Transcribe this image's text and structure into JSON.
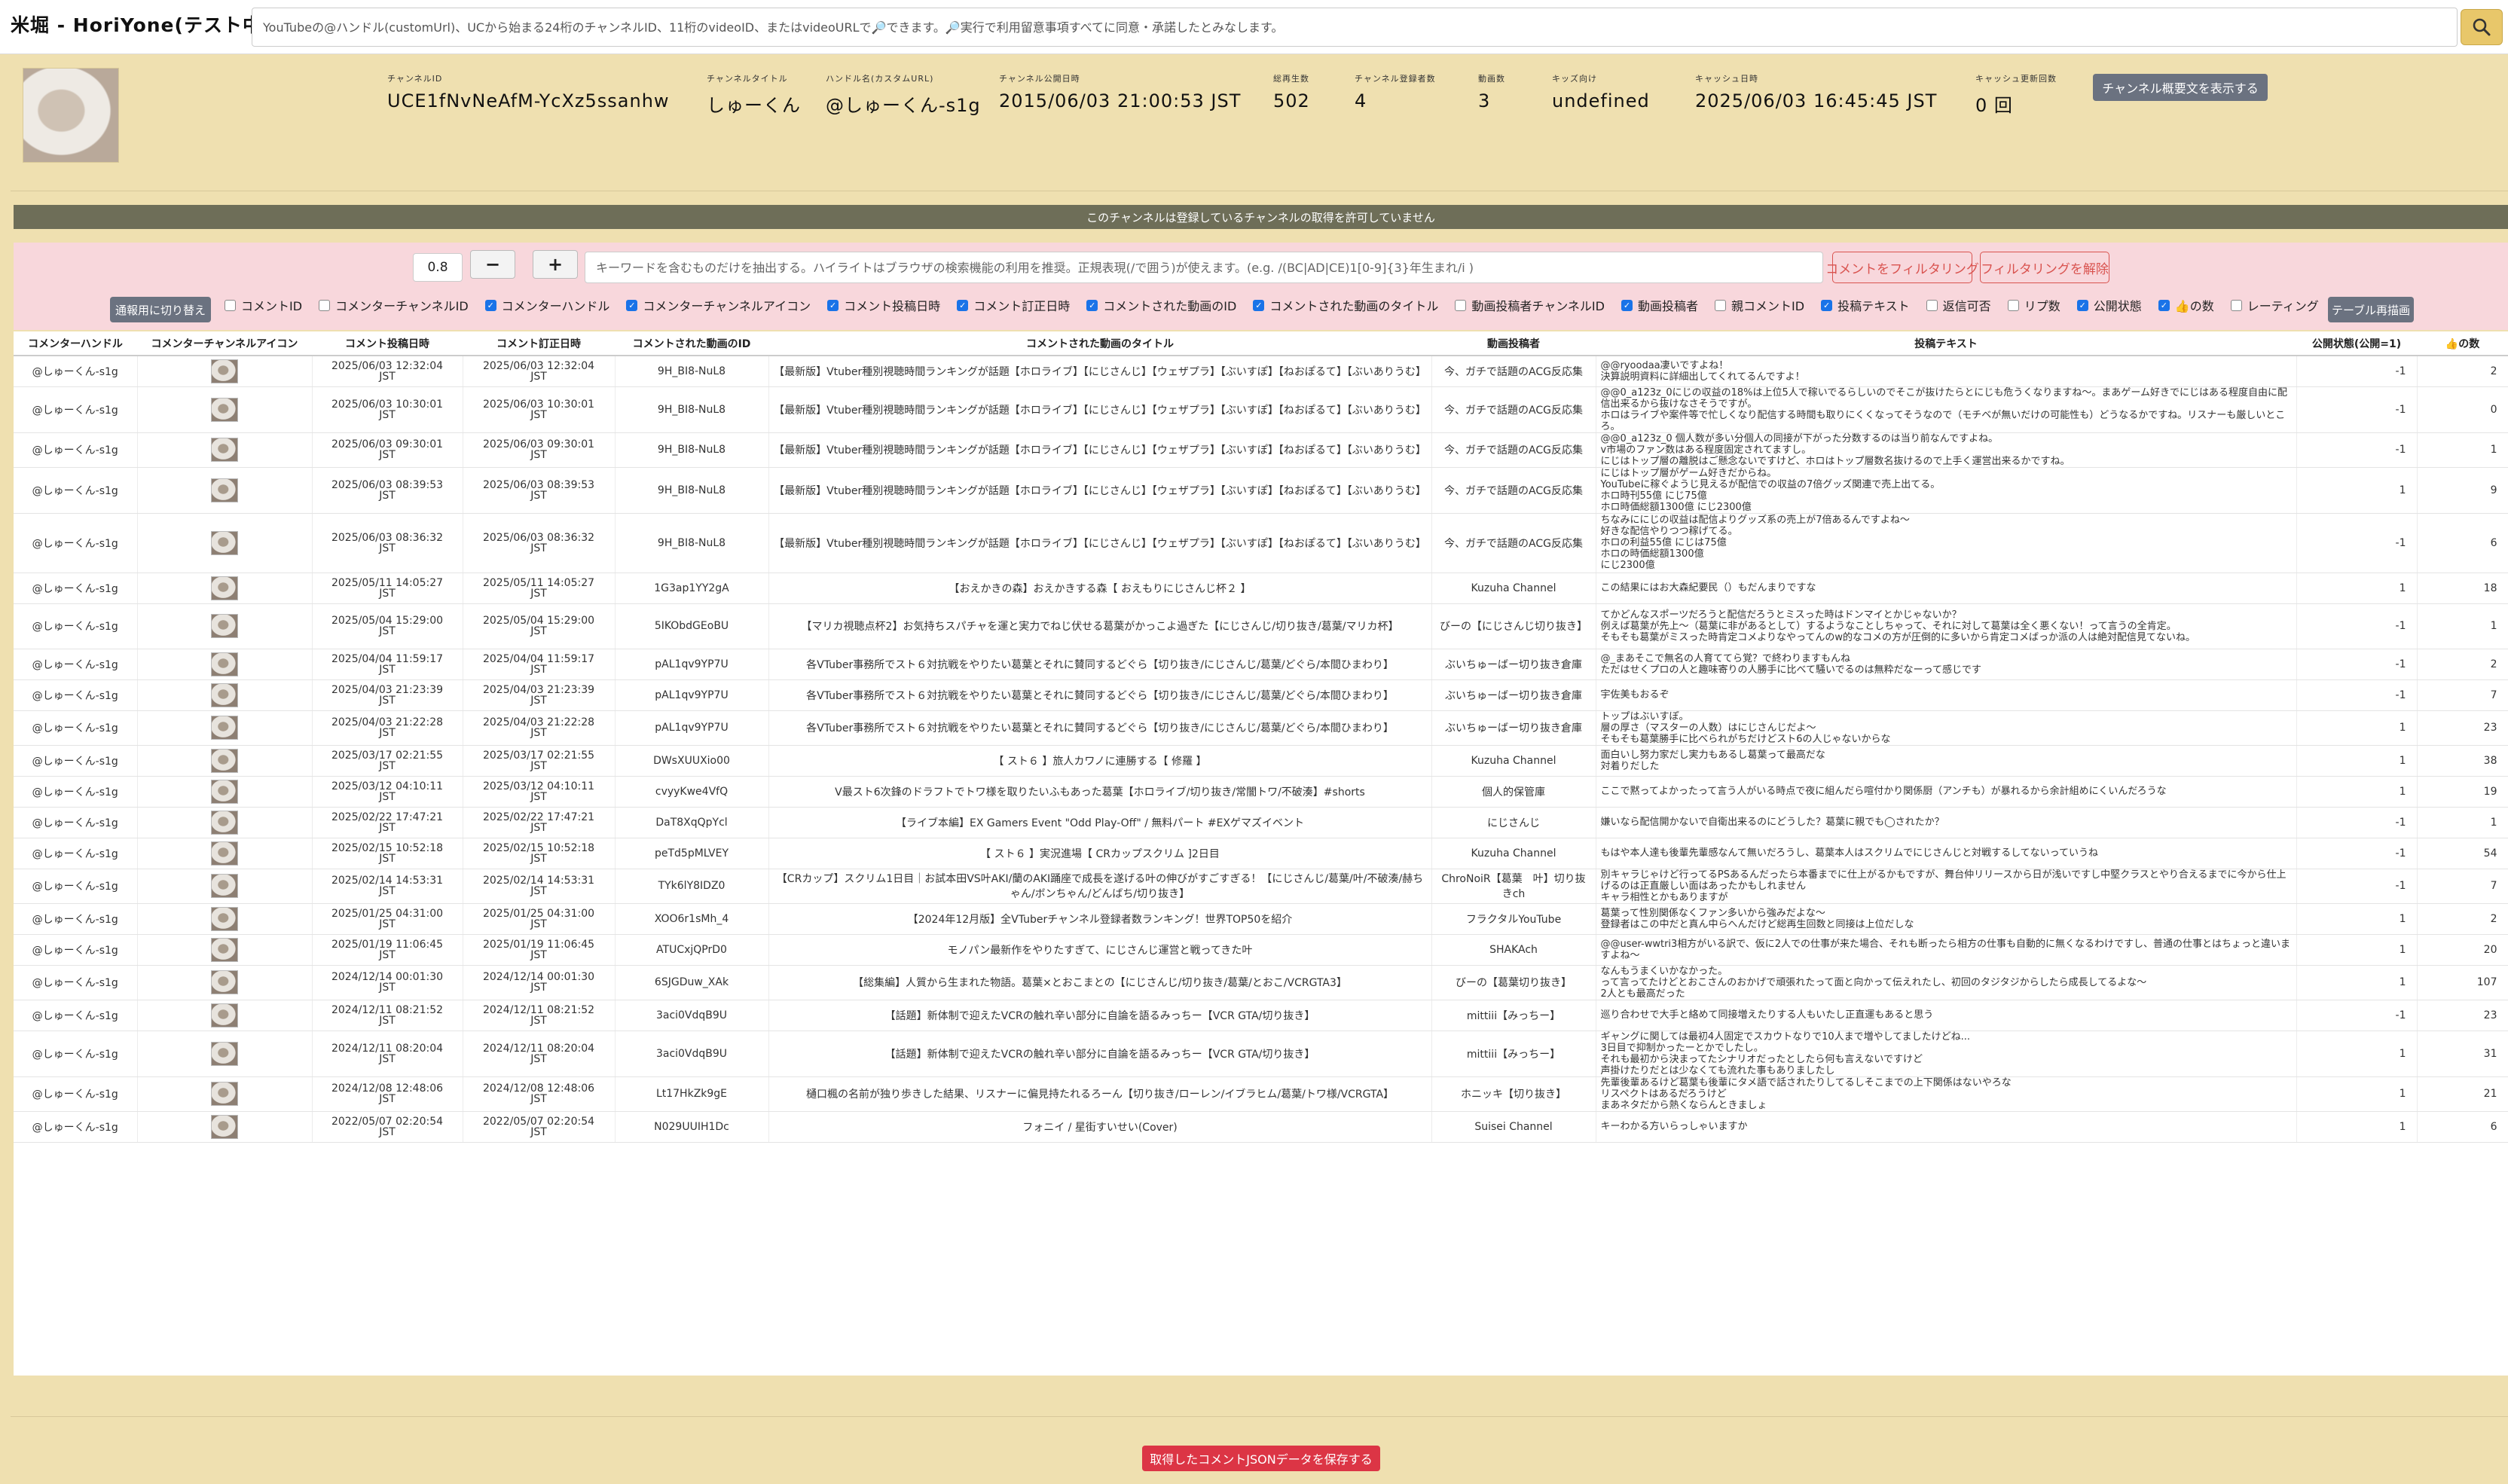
{
  "app_title": "米堀 - HoriYone(テスト中)",
  "search": {
    "placeholder": "YouTubeの@ハンドル(customUrl)、UCから始まる24桁のチャンネルID、11桁のvideoID、またはvideoURLで🔎できます。🔎実行で利用留意事項すべてに同意・承諾したとみなします。",
    "button_icon": "search-icon"
  },
  "channel": {
    "fields": [
      {
        "label": "チャンネルID",
        "value": "UCE1fNvNeAfM-YcXz5ssanhw"
      },
      {
        "label": "チャンネルタイトル",
        "value": "しゅーくん"
      },
      {
        "label": "ハンドル名(カスタムURL)",
        "value": "@しゅーくん-s1g"
      },
      {
        "label": "チャンネル公開日時",
        "value": "2015/06/03 21:00:53 JST"
      },
      {
        "label": "総再生数",
        "value": "502"
      },
      {
        "label": "チャンネル登録者数",
        "value": "4"
      },
      {
        "label": "動画数",
        "value": "3"
      },
      {
        "label": "キッズ向け",
        "value": "undefined"
      },
      {
        "label": "キャッシュ日時",
        "value": "2025/06/03 16:45:45 JST"
      },
      {
        "label": "キャッシュ更新回数",
        "value": "0 回"
      }
    ],
    "show_summary_label": "チャンネル概要文を表示する"
  },
  "notice": "このチャンネルは登録しているチャンネルの取得を許可していません",
  "filter": {
    "threshold": "0.8",
    "minus": "−",
    "plus": "+",
    "keyword_placeholder": "キーワードを含むものだけを抽出する。ハイライトはブラウザの検索機能の利用を推奨。正規表現(/で囲う)が使えます。(e.g. /(BC|AD|CE)1[0-9]{3}年生まれ/i )",
    "apply_label": "コメントをフィルタリング",
    "clear_label": "フィルタリングを解除",
    "switch_label": "通報用に切り替え",
    "redraw_label": "テーブル再描画",
    "checkboxes": [
      {
        "label": "コメントID",
        "checked": false
      },
      {
        "label": "コメンターチャンネルID",
        "checked": false
      },
      {
        "label": "コメンターハンドル",
        "checked": true
      },
      {
        "label": "コメンターチャンネルアイコン",
        "checked": true
      },
      {
        "label": "コメント投稿日時",
        "checked": true
      },
      {
        "label": "コメント訂正日時",
        "checked": true
      },
      {
        "label": "コメントされた動画のID",
        "checked": true
      },
      {
        "label": "コメントされた動画のタイトル",
        "checked": true
      },
      {
        "label": "動画投稿者チャンネルID",
        "checked": false
      },
      {
        "label": "動画投稿者",
        "checked": true
      },
      {
        "label": "親コメントID",
        "checked": false
      },
      {
        "label": "投稿テキスト",
        "checked": true
      },
      {
        "label": "返信可否",
        "checked": false
      },
      {
        "label": "リプ数",
        "checked": false
      },
      {
        "label": "公開状態",
        "checked": true
      },
      {
        "label": "👍の数",
        "checked": true
      },
      {
        "label": "レーティング",
        "checked": false
      }
    ]
  },
  "table": {
    "headers": [
      "コメンターハンドル",
      "コメンターチャンネルアイコン",
      "コメント投稿日時",
      "コメント訂正日時",
      "コメントされた動画のID",
      "コメントされた動画のタイトル",
      "動画投稿者",
      "投稿テキスト",
      "公開状態(公開=1)",
      "👍の数"
    ],
    "rows": [
      {
        "handle": "@しゅーくん-s1g",
        "posted": "2025/06/03 12:32:04\nJST",
        "edited": "2025/06/03 12:32:04\nJST",
        "video_id": "9H_BI8-NuL8",
        "title": "【最新版】Vtuber種別視聴時間ランキングが話題【ホロライブ】【にじさんじ】【ウェザプラ】【ぶいすぽ】【ねおぽるて】【ぶいありうむ】",
        "uploader": "今、ガチで話題のACG反応集",
        "text": "@@ryoodaa凄いですよね！\n決算説明資料に詳細出してくれてるんですよ！",
        "status": "-1",
        "likes": "2"
      },
      {
        "handle": "@しゅーくん-s1g",
        "posted": "2025/06/03 10:30:01\nJST",
        "edited": "2025/06/03 10:30:01\nJST",
        "video_id": "9H_BI8-NuL8",
        "title": "【最新版】Vtuber種別視聴時間ランキングが話題【ホロライブ】【にじさんじ】【ウェザプラ】【ぶいすぽ】【ねおぽるて】【ぶいありうむ】",
        "uploader": "今、ガチで話題のACG反応集",
        "text": "@@0_a123z_0にじの収益の18%は上位5人で稼いでるらしいのでそこが抜けたらとにじも危うくなりますね〜。まあゲーム好きでにじはある程度自由に配信出来るから抜けなさそうですが。\nホロはライブや案件等で忙しくなり配信する時間も取りにくくなってそうなので（モチベが無いだけの可能性も）どうなるかですね。リスナーも厳しいところ。",
        "status": "-1",
        "likes": "0"
      },
      {
        "handle": "@しゅーくん-s1g",
        "posted": "2025/06/03 09:30:01\nJST",
        "edited": "2025/06/03 09:30:01\nJST",
        "video_id": "9H_BI8-NuL8",
        "title": "【最新版】Vtuber種別視聴時間ランキングが話題【ホロライブ】【にじさんじ】【ウェザプラ】【ぶいすぽ】【ねおぽるて】【ぶいありうむ】",
        "uploader": "今、ガチで話題のACG反応集",
        "text": "@@0_a123z_0 個人数が多い分個人の同接が下がった分数するのは当り前なんですよね。\nv市場のファン数はある程度固定されてますし。\nにじはトップ層の離脱はご懸念ないですけど、ホロはトップ層数名抜けるので上手く運営出来るかですね。",
        "status": "-1",
        "likes": "1"
      },
      {
        "handle": "@しゅーくん-s1g",
        "posted": "2025/06/03 08:39:53\nJST",
        "edited": "2025/06/03 08:39:53\nJST",
        "video_id": "9H_BI8-NuL8",
        "title": "【最新版】Vtuber種別視聴時間ランキングが話題【ホロライブ】【にじさんじ】【ウェザプラ】【ぶいすぽ】【ねおぽるて】【ぶいありうむ】",
        "uploader": "今、ガチで話題のACG反応集",
        "text": "にじはトップ層がゲーム好きだからね。\nYouTubeに稼ぐようじ見えるが配信での収益の7倍グッズ関連で売上出てる。\nホロ時刊55億 にじ75億\nホロ時価総額1300億 にじ2300億",
        "status": "1",
        "likes": "9"
      },
      {
        "handle": "@しゅーくん-s1g",
        "posted": "2025/06/03 08:36:32\nJST",
        "edited": "2025/06/03 08:36:32\nJST",
        "video_id": "9H_BI8-NuL8",
        "title": "【最新版】Vtuber種別視聴時間ランキングが話題【ホロライブ】【にじさんじ】【ウェザプラ】【ぶいすぽ】【ねおぽるて】【ぶいありうむ】",
        "uploader": "今、ガチで話題のACG反応集",
        "text": "ちなみににじの収益は配信よりグッズ系の売上が7倍あるんですよね〜\n好きな配信やりつつ稼げてる。\nホロの利益55億 にじは75億\nホロの時価総額1300億\nにじ2300億",
        "status": "-1",
        "likes": "6"
      },
      {
        "handle": "@しゅーくん-s1g",
        "posted": "2025/05/11 14:05:27\nJST",
        "edited": "2025/05/11 14:05:27\nJST",
        "video_id": "1G3ap1YY2gA",
        "title": "【おえかきの森】おえかきする森【 おえもりにじさんじ杯２ 】",
        "uploader": "Kuzuha Channel",
        "text": "この結果にはお大森紀要民（）もだんまりですな",
        "status": "1",
        "likes": "18"
      },
      {
        "handle": "@しゅーくん-s1g",
        "posted": "2025/05/04 15:29:00\nJST",
        "edited": "2025/05/04 15:29:00\nJST",
        "video_id": "5IKObdGEoBU",
        "title": "【マリカ視聴点杯2】お気持ちスパチャを運と実力でねじ伏せる葛葉がかっこよ過ぎた【にじさんじ/切り抜き/葛葉/マリカ杯】",
        "uploader": "びーの【にじさんじ切り抜き】",
        "text": "てかどんなスポーツだろうと配信だろうとミスった時はドンマイとかじゃないか？\n例えば葛葉が先上〜（葛葉に非があるとして）するようなことしちゃって、それに対して葛葉は全く悪くない！って言うの全肯定。\nそもそも葛葉がミスった時肯定コメよりなやってんのw的なコメの方が圧倒的に多いから肯定コメばっか派の人は絶対配信見てないね。",
        "status": "-1",
        "likes": "1"
      },
      {
        "handle": "@しゅーくん-s1g",
        "posted": "2025/04/04 11:59:17\nJST",
        "edited": "2025/04/04 11:59:17\nJST",
        "video_id": "pAL1qv9YP7U",
        "title": "各VTuber事務所でスト６対抗戦をやりたい葛葉とそれに賛同するどぐら【切り抜き/にじさんじ/葛葉/どぐら/本間ひまわり】",
        "uploader": "ぶいちゅーばー切り抜き倉庫",
        "text": "@_まあそこで無名の人育ててら覚？で終わりますもんね\nただはせくプロの人と趣味寄りの人勝手に比べて騒いでるのは無粋だなーって感じです",
        "status": "-1",
        "likes": "2"
      },
      {
        "handle": "@しゅーくん-s1g",
        "posted": "2025/04/03 21:23:39\nJST",
        "edited": "2025/04/03 21:23:39\nJST",
        "video_id": "pAL1qv9YP7U",
        "title": "各VTuber事務所でスト６対抗戦をやりたい葛葉とそれに賛同するどぐら【切り抜き/にじさんじ/葛葉/どぐら/本間ひまわり】",
        "uploader": "ぶいちゅーばー切り抜き倉庫",
        "text": "宇佐美もおるぞ",
        "status": "-1",
        "likes": "7"
      },
      {
        "handle": "@しゅーくん-s1g",
        "posted": "2025/04/03 21:22:28\nJST",
        "edited": "2025/04/03 21:22:28\nJST",
        "video_id": "pAL1qv9YP7U",
        "title": "各VTuber事務所でスト６対抗戦をやりたい葛葉とそれに賛同するどぐら【切り抜き/にじさんじ/葛葉/どぐら/本間ひまわり】",
        "uploader": "ぶいちゅーばー切り抜き倉庫",
        "text": "トップはぶいすぽ。\n層の厚さ（マスターの人数）はにじさんじだよ〜\nそもそも葛葉勝手に比べられがちだけどスト6の人じゃないからな",
        "status": "1",
        "likes": "23"
      },
      {
        "handle": "@しゅーくん-s1g",
        "posted": "2025/03/17 02:21:55\nJST",
        "edited": "2025/03/17 02:21:55\nJST",
        "video_id": "DWsXUUXio00",
        "title": "【 スト６ 】旅人カワノに連勝する【 修羅 】",
        "uploader": "Kuzuha Channel",
        "text": "面白いし努力家だし実力もあるし葛葉って最高だな\n対着りだした",
        "status": "1",
        "likes": "38"
      },
      {
        "handle": "@しゅーくん-s1g",
        "posted": "2025/03/12 04:10:11\nJST",
        "edited": "2025/03/12 04:10:11\nJST",
        "video_id": "cvyyKwe4VfQ",
        "title": "V最スト6次鋒のドラフトでトワ様を取りたいふもあった葛葉【ホロライブ/切り抜き/常闇トワ/不破湊】#shorts",
        "uploader": "個人的保管庫",
        "text": "ここで黙ってよかったって言う人がいる時点で夜に組んだら喧付かり関係厨（アンチも）が暴れるから余計組めにくいんだろうな",
        "status": "1",
        "likes": "19"
      },
      {
        "handle": "@しゅーくん-s1g",
        "posted": "2025/02/22 17:47:21\nJST",
        "edited": "2025/02/22 17:47:21\nJST",
        "video_id": "DaT8XqQpYcl",
        "title": "【ライブ本編】EX Gamers Event \"Odd Play-Off\" / 無料パート #EXゲマズイベント",
        "uploader": "にじさんじ",
        "text": "嫌いなら配信開かないで自衛出来るのにどうした？葛葉に親でも◯されたか？",
        "status": "-1",
        "likes": "1"
      },
      {
        "handle": "@しゅーくん-s1g",
        "posted": "2025/02/15 10:52:18\nJST",
        "edited": "2025/02/15 10:52:18\nJST",
        "video_id": "peTd5pMLVEY",
        "title": "【 スト６ 】実況進場【 CRカップスクリム ]2日目",
        "uploader": "Kuzuha Channel",
        "text": "もはや本人達も後輩先輩感なんて無いだろうし、葛葉本人はスクリムでにじさんじと対戦するしてないっていうね",
        "status": "-1",
        "likes": "54"
      },
      {
        "handle": "@しゅーくん-s1g",
        "posted": "2025/02/14 14:53:31\nJST",
        "edited": "2025/02/14 14:53:31\nJST",
        "video_id": "TYk6lY8IDZ0",
        "title": "【CRカップ】スクリム1日目｜お試本田VS叶AKI/蘭のAKI踊座で成長を遂げる叶の伸びがすごすぎる！【にじさんじ/葛葉/叶/不破湊/赫ちゃん/ボンちゃん/どんばち/切り抜き】",
        "uploader": "ChroNoiR【葛葉　叶】切り抜きch",
        "text": "別キャラじゃけど行ってるPSあるんだったら本番までに仕上がるかもですが、舞台仲リリースから日が浅いですし中堅クラスとやり合えるまでに今から仕上げるのは正直厳しい面はあったかもしれません\nキャラ相性とかもありますが",
        "status": "-1",
        "likes": "7"
      },
      {
        "handle": "@しゅーくん-s1g",
        "posted": "2025/01/25 04:31:00\nJST",
        "edited": "2025/01/25 04:31:00\nJST",
        "video_id": "XOO6r1sMh_4",
        "title": "【2024年12月版】全VTuberチャンネル登録者数ランキング！世界TOP50を紹介",
        "uploader": "フラクタルYouTube",
        "text": "葛葉って性別関係なくファン多いから強みだよな〜\n登録者はこの中だと真ん中らへんだけど総再生回数と同接は上位だしな",
        "status": "1",
        "likes": "2"
      },
      {
        "handle": "@しゅーくん-s1g",
        "posted": "2025/01/19 11:06:45\nJST",
        "edited": "2025/01/19 11:06:45\nJST",
        "video_id": "ATUCxjQPrD0",
        "title": "モノパン最新作をやりたすぎて、にじさんじ運営と戦ってきた叶",
        "uploader": "SHAKAch",
        "text": "@@user-wwtri3相方がいる訳で、仮に2人での仕事が来た場合、それも断ったら相方の仕事も自動的に無くなるわけですし、普通の仕事とはちょっと違いますよね〜",
        "status": "1",
        "likes": "20"
      },
      {
        "handle": "@しゅーくん-s1g",
        "posted": "2024/12/14 00:01:30\nJST",
        "edited": "2024/12/14 00:01:30\nJST",
        "video_id": "6SJGDuw_XAk",
        "title": "【総集編】人質から生まれた物語。葛葉×とおこまとの【にじさんじ/切り抜き/葛葉/とおこ/VCRGTA3】",
        "uploader": "びーの【葛葉切り抜き】",
        "text": "なんもうまくいかなかった。\nって言ってたけどとおこさんのおかげで頑張れたって面と向かって伝えれたし、初回のタジタジからしたら成長してるよな〜\n2人とも最高だった",
        "status": "1",
        "likes": "107"
      },
      {
        "handle": "@しゅーくん-s1g",
        "posted": "2024/12/11 08:21:52\nJST",
        "edited": "2024/12/11 08:21:52\nJST",
        "video_id": "3aci0VdqB9U",
        "title": "【話題】新体制で迎えたVCRの触れ辛い部分に自論を語るみっちー【VCR GTA/切り抜き】",
        "uploader": "mittiii【みっちー】",
        "text": "巡り合わせで大手と絡めて同接増えたりする人もいたし正直運もあると思う",
        "status": "-1",
        "likes": "23"
      },
      {
        "handle": "@しゅーくん-s1g",
        "posted": "2024/12/11 08:20:04\nJST",
        "edited": "2024/12/11 08:20:04\nJST",
        "video_id": "3aci0VdqB9U",
        "title": "【話題】新体制で迎えたVCRの触れ辛い部分に自論を語るみっちー【VCR GTA/切り抜き】",
        "uploader": "mittiii【みっちー】",
        "text": "ギャングに関しては最初4人固定でスカウトなりで10人まで増やしてましたけどね...\n3日目で抑制かったーとかでしたし。\nそれも最初から決まってたシナリオだったとしたら何も言えないですけど\n声掛けたりだとは少なくても流れた事もありましたし",
        "status": "1",
        "likes": "31"
      },
      {
        "handle": "@しゅーくん-s1g",
        "posted": "2024/12/08 12:48:06\nJST",
        "edited": "2024/12/08 12:48:06\nJST",
        "video_id": "Lt17HkZk9gE",
        "title": "樋口楓の名前が独り歩きした結果、リスナーに偏見持たれるろーん【切り抜き/ローレン/イブラヒム/葛葉/トワ様/VCRGTA】",
        "uploader": "ホニッキ【切り抜き】",
        "text": "先輩後輩あるけど葛葉も後輩にタメ語で話されたりしてるしそこまでの上下関係はないやろな\nリスペクトはあるだろうけど\nまあネタだから熱くならんときましょ",
        "status": "1",
        "likes": "21"
      },
      {
        "handle": "@しゅーくん-s1g",
        "posted": "2022/05/07 02:20:54\nJST",
        "edited": "2022/05/07 02:20:54\nJST",
        "video_id": "N029UUIH1Dc",
        "title": "フォニイ / 星街すいせい(Cover)",
        "uploader": "Suisei Channel",
        "text": "キーわかる方いらっしゃいますか",
        "status": "1",
        "likes": "6"
      }
    ]
  },
  "save_label": "取得したコメントJSONデータを保存する"
}
